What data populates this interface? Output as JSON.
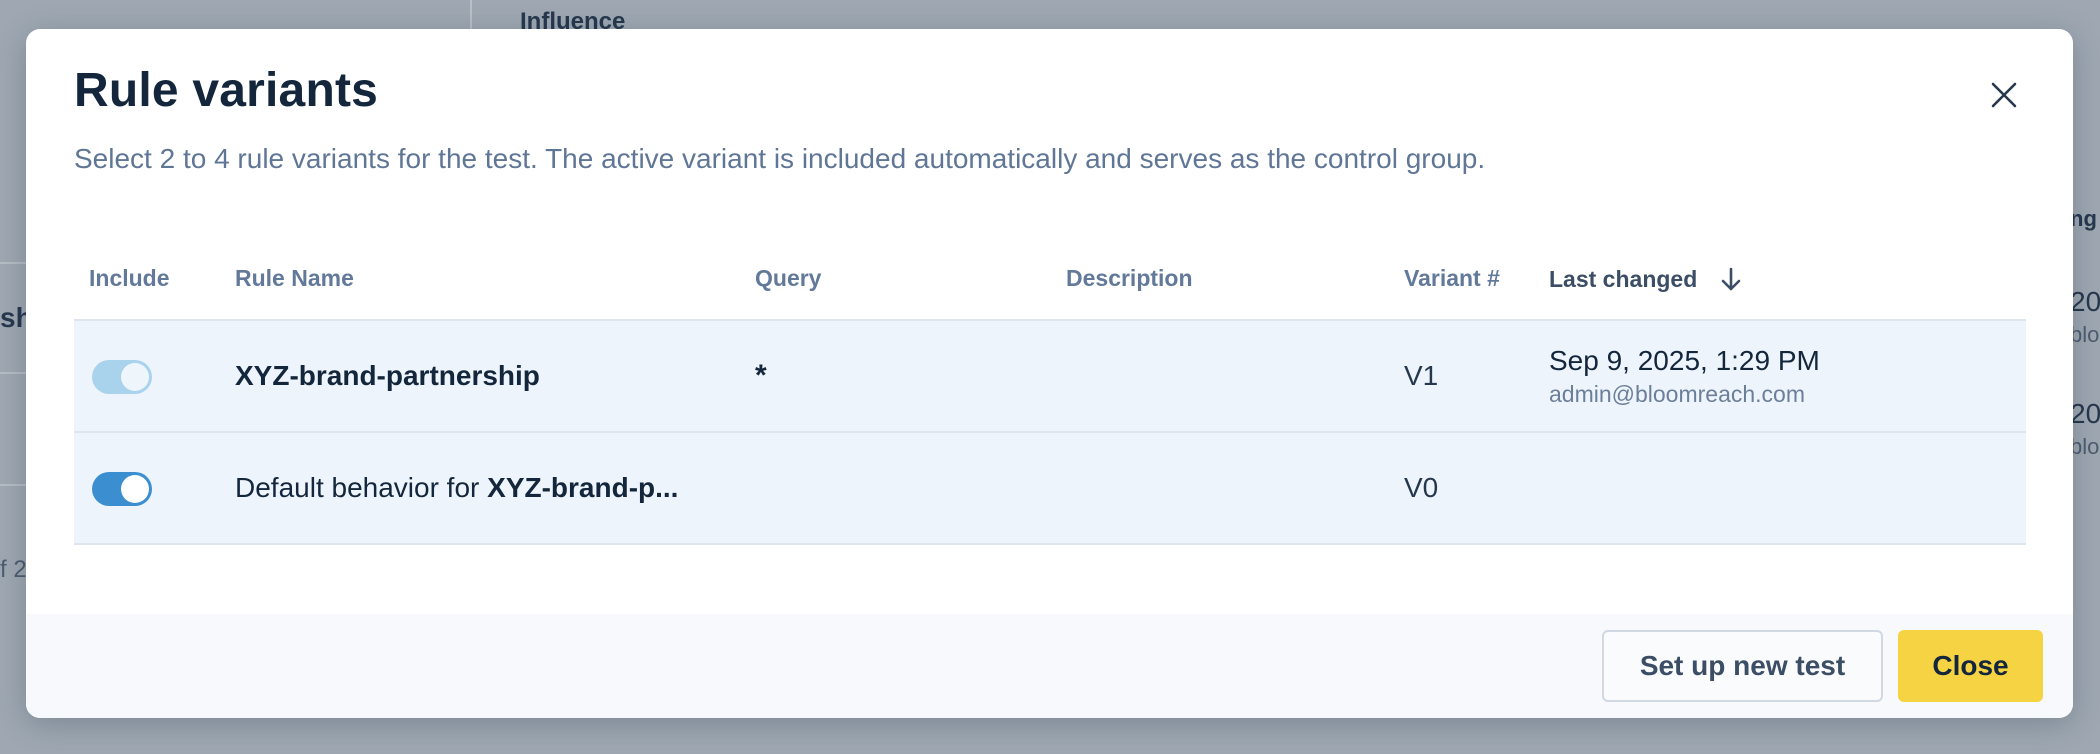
{
  "background": {
    "influence_label": "Influence",
    "partial_left_text": "sh",
    "partial_pagination_text": "f 2",
    "partial_right_header": "ng",
    "partial_right_date_1": "20",
    "partial_right_email_1": "blo",
    "partial_right_date_2": "20",
    "partial_right_email_2": "blo"
  },
  "modal": {
    "title": "Rule variants",
    "subtitle": "Select 2 to 4 rule variants for the test. The active variant is included automatically and serves as the control group.",
    "close_icon": "close-icon"
  },
  "table": {
    "columns": {
      "include": "Include",
      "rule_name": "Rule Name",
      "query": "Query",
      "description": "Description",
      "variant": "Variant #",
      "last_changed": "Last changed"
    },
    "sort_icon": "arrow-down-icon",
    "rows": [
      {
        "included": true,
        "toggle_disabled": true,
        "rule_name": "XYZ-brand-partnership",
        "query": "*",
        "description": "",
        "variant": "V1",
        "last_changed_date": "Sep 9, 2025, 1:29 PM",
        "last_changed_by": "admin@bloomreach.com"
      },
      {
        "included": true,
        "toggle_disabled": false,
        "rule_name_prefix": "Default behavior for ",
        "rule_name_bold": "XYZ-brand-p...",
        "query": "",
        "description": "",
        "variant": "V0",
        "last_changed_date": "",
        "last_changed_by": ""
      }
    ]
  },
  "footer": {
    "setup_button": "Set up new test",
    "close_button": "Close"
  },
  "colors": {
    "primary_button": "#f6d343",
    "toggle_on": "#3b8fd0",
    "toggle_disabled": "#a9d3ec",
    "row_highlight": "#edf4fc",
    "title_text": "#13263b"
  }
}
